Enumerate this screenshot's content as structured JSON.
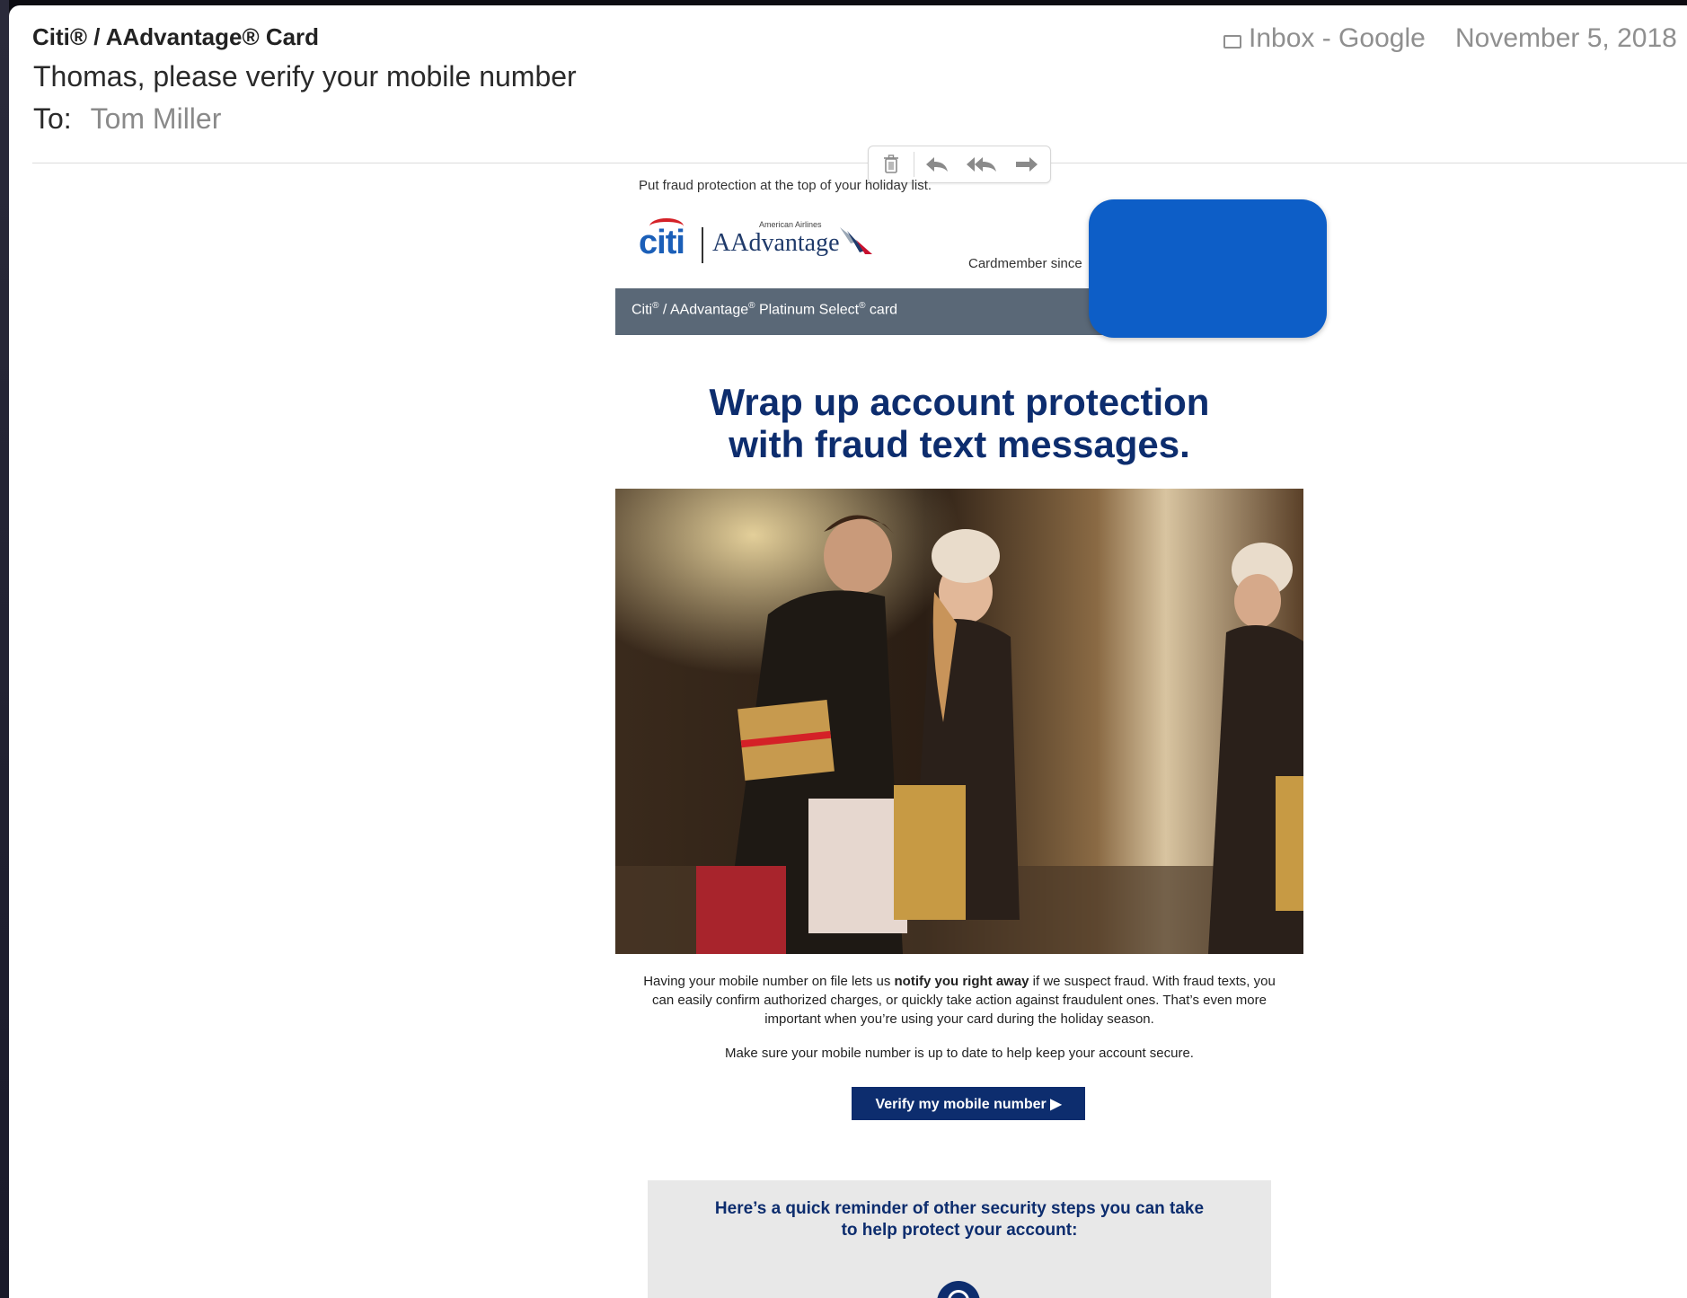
{
  "header": {
    "from": "Citi® / AAdvantage® Card",
    "subject": "Thomas, please verify your mobile number",
    "to_label": "To:",
    "to_name": "Tom Miller",
    "mailbox": "Inbox - Google",
    "date": "November 5, 2018"
  },
  "toolbar": {
    "icons": [
      "trash-icon",
      "reply-icon",
      "reply-all-icon",
      "forward-icon"
    ]
  },
  "email": {
    "preheader": "Put fraud protection at the top of your holiday list.",
    "citi_logo": "citi",
    "aa_small": "American Airlines",
    "aa_logo": "AAdvantage",
    "cardmember_since": "Cardmember since",
    "card_bar": {
      "citi": "Citi",
      "aadvantage": " / AAdvantage",
      "platinum": " Platinum Select",
      "card": " card",
      "reg": "®"
    },
    "headline_line1": "Wrap up account protection",
    "headline_line2": "with fraud text messages.",
    "body_p1_a": "Having your mobile number on file lets us ",
    "body_p1_bold": "notify you right away",
    "body_p1_b": " if we suspect fraud. With fraud texts, you can easily confirm authorized charges, or quickly take action against fraudulent ones. That’s even more important when you’re using your card during the holiday season.",
    "body_p2": "Make sure your mobile number is up to date to help keep your account secure.",
    "cta_label": "Verify my mobile number ▶",
    "reminder_line1": "Here’s a quick reminder of other security steps you can take",
    "reminder_line2": "to help protect your account:"
  },
  "colors": {
    "navy": "#0d2d6e",
    "citi_blue": "#1b5fb8",
    "card_bar": "#5a6877",
    "redaction": "#0d5ec7"
  }
}
